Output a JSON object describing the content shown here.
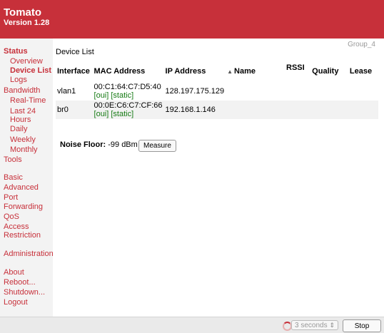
{
  "header": {
    "brand": "Tomato",
    "version": "Version 1.28"
  },
  "sidebar": {
    "items": [
      {
        "label": "Status",
        "level": "top",
        "active": true
      },
      {
        "label": "Overview",
        "level": "sub"
      },
      {
        "label": "Device List",
        "level": "sub",
        "active": true
      },
      {
        "label": "Logs",
        "level": "sub"
      },
      {
        "label": "Bandwidth",
        "level": "top"
      },
      {
        "label": "Real-Time",
        "level": "sub"
      },
      {
        "label": "Last 24",
        "level": "sub"
      },
      {
        "label": "Hours",
        "level": "sub"
      },
      {
        "label": "Daily",
        "level": "sub"
      },
      {
        "label": "Weekly",
        "level": "sub"
      },
      {
        "label": "Monthly",
        "level": "sub"
      },
      {
        "label": "Tools",
        "level": "top"
      },
      {
        "label": "Basic",
        "level": "top"
      },
      {
        "label": "Advanced",
        "level": "top"
      },
      {
        "label": "Port",
        "level": "top"
      },
      {
        "label": "Forwarding",
        "level": "top"
      },
      {
        "label": "QoS",
        "level": "top"
      },
      {
        "label": "Access",
        "level": "top"
      },
      {
        "label": "Restriction",
        "level": "top"
      },
      {
        "label": "Administration",
        "level": "top"
      },
      {
        "label": "About",
        "level": "top"
      },
      {
        "label": "Reboot...",
        "level": "top"
      },
      {
        "label": "Shutdown...",
        "level": "top"
      },
      {
        "label": "Logout",
        "level": "top"
      }
    ]
  },
  "main": {
    "group": "Group_4",
    "title": "Device List",
    "columns": [
      "Interface",
      "MAC Address",
      "IP Address",
      "Name",
      "RSSI",
      "Quality",
      "Lease"
    ],
    "rows": [
      {
        "interface": "vlan1",
        "mac": "00:C1:64:C7:D5:40",
        "oui": "[oui]",
        "static": "[static]",
        "ip": "128.197.175.129",
        "name": "",
        "rssi": "",
        "quality": "",
        "lease": ""
      },
      {
        "interface": "br0",
        "mac": "00:0E:C6:C7:CF:66",
        "oui": "[oui]",
        "static": "[static]",
        "ip": "192.168.1.146",
        "name": "",
        "rssi": "",
        "quality": "",
        "lease": ""
      }
    ],
    "noise": {
      "label": "Noise Floor:",
      "value": "-99 dBm",
      "button": "Measure"
    }
  },
  "footer": {
    "refresh": "3 seconds",
    "stop": "Stop"
  },
  "colors": {
    "accent": "#c7303a",
    "link_green": "#157a13"
  }
}
